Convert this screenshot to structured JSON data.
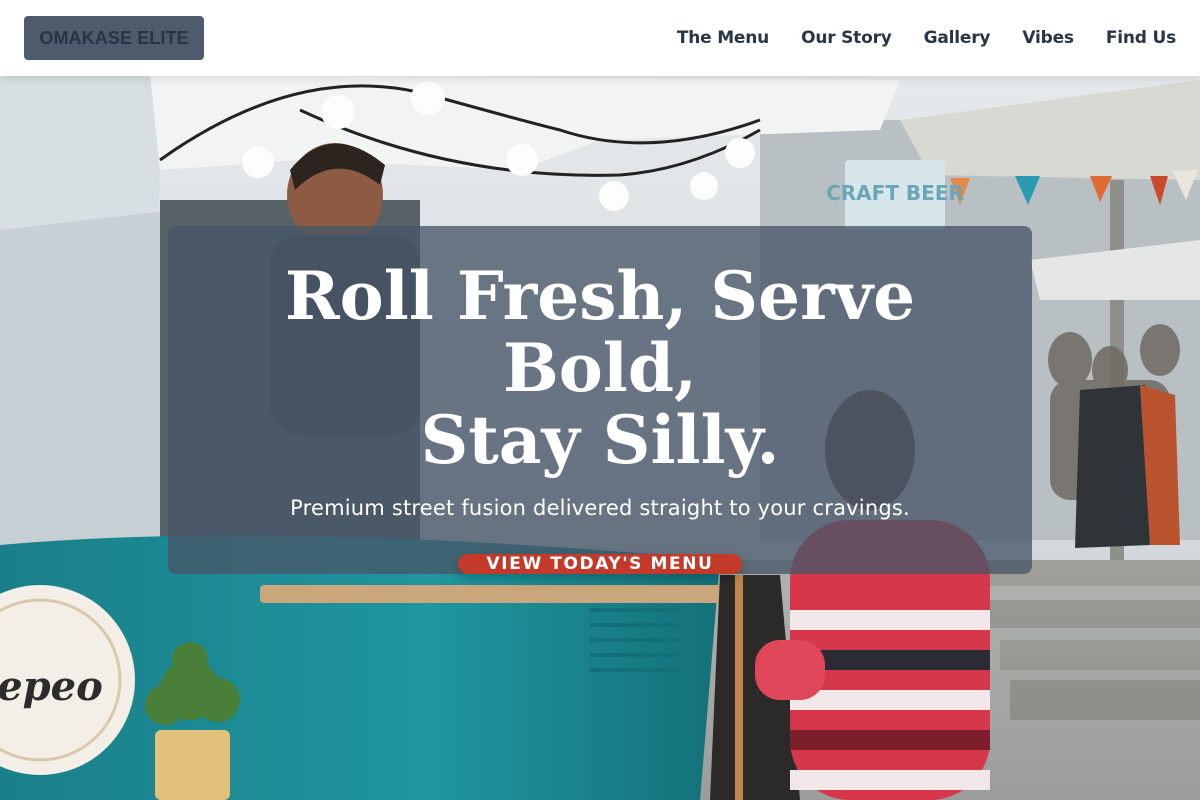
{
  "brand": {
    "logo_text": "OMAKASE ELITE"
  },
  "nav": {
    "items": [
      {
        "label": "The Menu"
      },
      {
        "label": "Our Story"
      },
      {
        "label": "Gallery"
      },
      {
        "label": "Vibes"
      },
      {
        "label": "Find Us"
      }
    ]
  },
  "hero": {
    "title_line1": "Roll Fresh, Serve Bold,",
    "title_line2": "Stay Silly.",
    "subtitle": "Premium street fusion delivered straight to your cravings.",
    "cta_label": "VIEW TODAY'S MENU",
    "background_description": "food truck market scene",
    "truck_sign_text": "epeo",
    "banner_sign_text": "CRAFT BEER"
  },
  "colors": {
    "header_bg": "#ffffff",
    "logo_bg": "#4d5b6d",
    "nav_text": "#2b3644",
    "card_overlay": "#485668",
    "cta_bg": "#c43a2a",
    "truck_teal": "#1f8e98"
  }
}
